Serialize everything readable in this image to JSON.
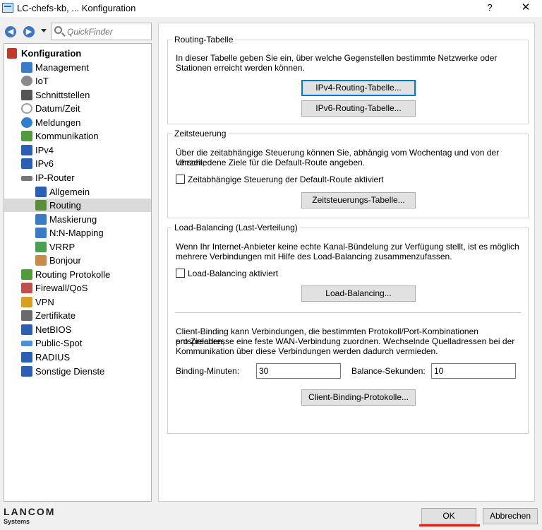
{
  "window": {
    "title": "LC-chefs-kb, ... Konfiguration",
    "help": "?",
    "close": "✕"
  },
  "nav": {
    "back": "◀",
    "forward": "▶",
    "quickfinder_placeholder": "QuickFinder"
  },
  "tree": {
    "root": "Konfiguration",
    "items": [
      {
        "label": "Management",
        "color": "#3a7bc8"
      },
      {
        "label": "IoT",
        "color": "#8a8a8a"
      },
      {
        "label": "Schnittstellen",
        "color": "#555555"
      },
      {
        "label": "Datum/Zeit",
        "color": "#9aa0a6"
      },
      {
        "label": "Meldungen",
        "color": "#2f7fd1"
      },
      {
        "label": "Kommunikation",
        "color": "#4f9d3a"
      },
      {
        "label": "IPv4",
        "color": "#2b5fb3"
      },
      {
        "label": "IPv6",
        "color": "#2b5fb3"
      },
      {
        "label": "IP-Router",
        "color": "#777777"
      },
      {
        "label": "Allgemein",
        "color": "#2b5fb3"
      },
      {
        "label": "Routing",
        "color": "#5a8f3a"
      },
      {
        "label": "Maskierung",
        "color": "#3a7bc8"
      },
      {
        "label": "N:N-Mapping",
        "color": "#3a7bc8"
      },
      {
        "label": "VRRP",
        "color": "#4aa050"
      },
      {
        "label": "Bonjour",
        "color": "#c98b4a"
      },
      {
        "label": "Routing Protokolle",
        "color": "#4f9d3a"
      },
      {
        "label": "Firewall/QoS",
        "color": "#c0504d"
      },
      {
        "label": "VPN",
        "color": "#d8a020"
      },
      {
        "label": "Zertifikate",
        "color": "#6a6a6a"
      },
      {
        "label": "NetBIOS",
        "color": "#2b5fb3"
      },
      {
        "label": "Public-Spot",
        "color": "#4a90d9"
      },
      {
        "label": "RADIUS",
        "color": "#2b5fb3"
      },
      {
        "label": "Sonstige Dienste",
        "color": "#2b5fb3"
      }
    ]
  },
  "logo": {
    "brand": "LANCOM",
    "sub": "Systems"
  },
  "routing": {
    "legend": "Routing-Tabelle",
    "desc1": "In dieser Tabelle geben Sie ein, über welche Gegenstellen bestimmte Netzwerke oder",
    "desc2": "Stationen erreicht werden können.",
    "ipv4_btn": "IPv4-Routing-Tabelle...",
    "ipv6_btn": "IPv6-Routing-Tabelle..."
  },
  "zeit": {
    "legend": "Zeitsteuerung",
    "desc1": "Über die zeitabhängige Steuerung können Sie, abhängig vom Wochentag und von der Uhrzeit,",
    "desc2": "verschiedene Ziele für die Default-Route angeben.",
    "checkbox": "Zeitabhängige Steuerung der Default-Route aktiviert",
    "btn": "Zeitsteuerungs-Tabelle..."
  },
  "lb": {
    "legend": "Load-Balancing (Last-Verteilung)",
    "desc1": "Wenn Ihr Internet-Anbieter keine echte Kanal-Bündelung zur Verfügung stellt, ist es möglich",
    "desc2": "mehrere Verbindungen mit Hilfe des Load-Balancing zusammenzufassen.",
    "checkbox": "Load-Balancing aktiviert",
    "btn": "Load-Balancing...",
    "cb1": "Client-Binding kann Verbindungen, die bestimmten Protokoll/Port-Kombinationen entsprechen,",
    "cb2": "pro Zieladresse eine feste WAN-Verbindung zuordnen. Wechselnde Quelladressen bei der",
    "cb3": "Kommunikation über diese Verbindungen werden dadurch vermieden.",
    "binding_label": "Binding-Minuten:",
    "binding_value": "30",
    "balance_label": "Balance-Sekunden:",
    "balance_value": "10",
    "proto_btn": "Client-Binding-Protokolle..."
  },
  "footer": {
    "ok": "OK",
    "cancel": "Abbrechen"
  }
}
